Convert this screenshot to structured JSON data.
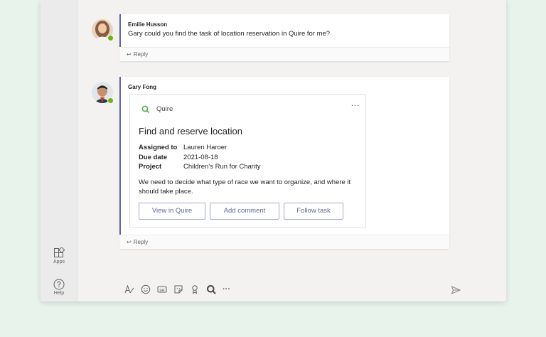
{
  "rail": {
    "apps_label": "Apps",
    "help_label": "Help"
  },
  "messages": [
    {
      "author": "Emilie Husson",
      "text": "Gary could you find the task of location reservation in Quire for me?",
      "reply_label": "Reply"
    },
    {
      "author": "Gary Fong",
      "reply_label": "Reply",
      "card": {
        "app_name": "Quire",
        "more_label": "...",
        "title": "Find and reserve location",
        "facts": [
          {
            "key": "Assigned to",
            "value": "Lauren Haroer"
          },
          {
            "key": "Due date",
            "value": "2021-08-18"
          },
          {
            "key": "Project",
            "value": "Children's Run for Charity"
          }
        ],
        "description": "We need to decide what type of race we want to organize, and where it should take place.",
        "buttons": [
          "View in Quire",
          "Add comment",
          "Follow task"
        ]
      }
    }
  ],
  "compose": {
    "icons": [
      "format-icon",
      "emoji-icon",
      "gif-icon",
      "sticker-icon",
      "praise-icon",
      "quire-icon",
      "more-icon",
      "send-icon"
    ],
    "more_label": "···"
  },
  "colors": {
    "accent": "#6264a7",
    "presence": "#6bb700",
    "quire": "#4caf50",
    "background": "#e8f3ec"
  }
}
